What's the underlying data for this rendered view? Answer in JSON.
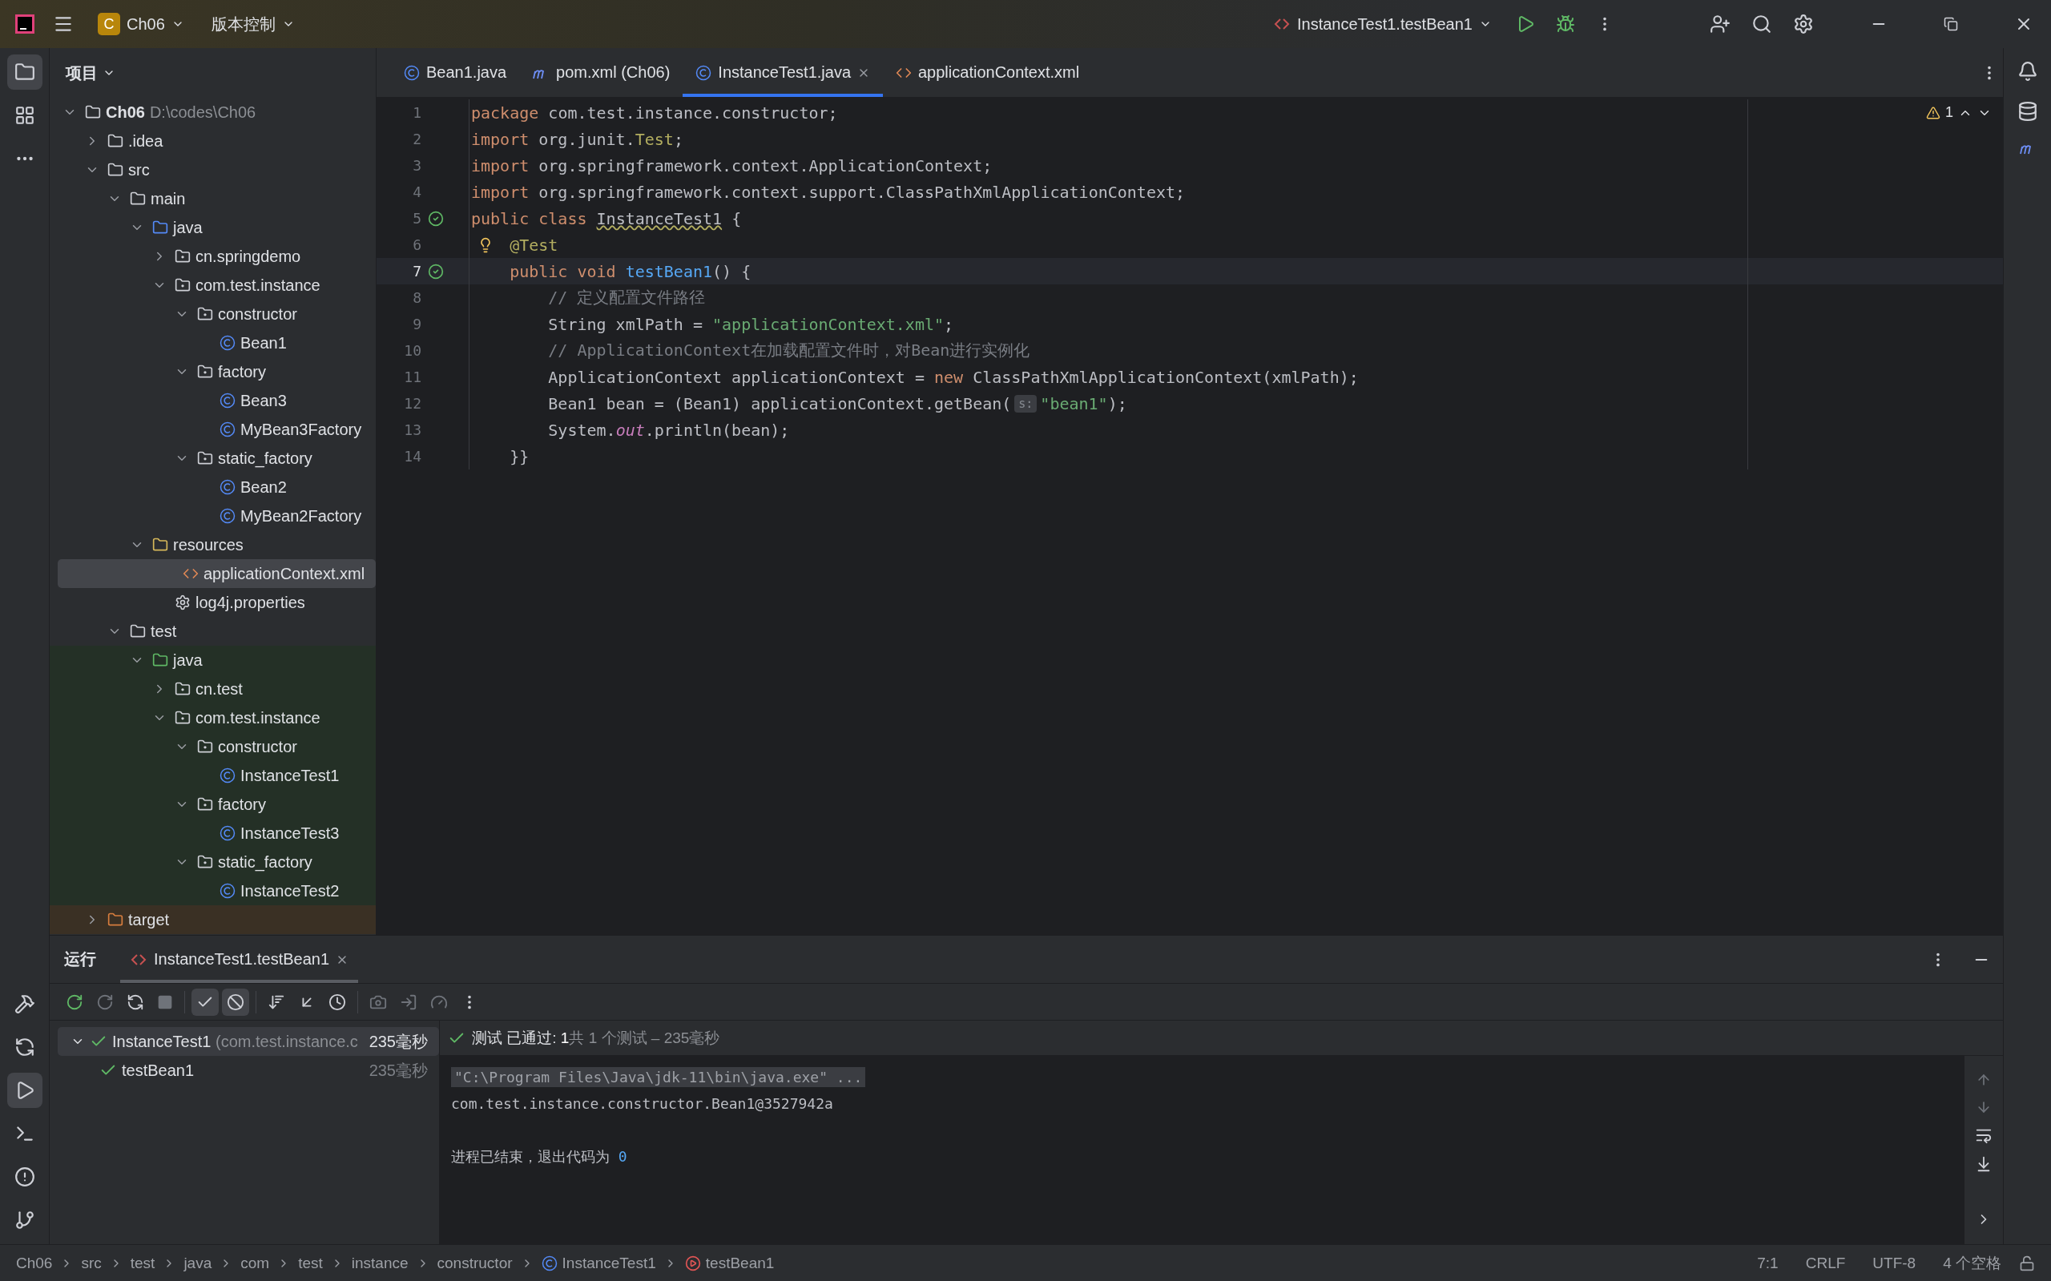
{
  "title_bar": {
    "project_badge": "C",
    "project": "Ch06",
    "vcs": "版本控制",
    "run_config": "InstanceTest1.testBean1"
  },
  "tool_strip_top": [
    {
      "selected": true
    },
    {
      "selected": false
    },
    {
      "selected": false
    }
  ],
  "tool_strip_bottom": [
    {
      "selected": false
    },
    {
      "selected": false
    },
    {
      "selected": true
    },
    {
      "selected": false
    },
    {
      "selected": false
    },
    {
      "selected": false
    }
  ],
  "project_panel": {
    "title": "项目",
    "tree": [
      {
        "name": "Ch06",
        "path": "D:\\codes\\Ch06",
        "kind": "project",
        "expanded": true,
        "selected": false,
        "children": [
          {
            "name": ".idea",
            "kind": "folder",
            "expanded": false,
            "selected": false
          },
          {
            "name": "src",
            "kind": "folder",
            "expanded": true,
            "selected": false,
            "children": [
              {
                "name": "main",
                "kind": "folder",
                "expanded": true,
                "selected": false,
                "children": [
                  {
                    "name": "java",
                    "kind": "source-folder",
                    "expanded": true,
                    "selected": false,
                    "children": [
                      {
                        "name": "cn.springdemo",
                        "kind": "package",
                        "expanded": false,
                        "selected": false
                      },
                      {
                        "name": "com.test.instance",
                        "kind": "package",
                        "expanded": true,
                        "selected": false,
                        "children": [
                          {
                            "name": "constructor",
                            "kind": "package",
                            "expanded": true,
                            "selected": false,
                            "children": [
                              {
                                "name": "Bean1",
                                "kind": "class",
                                "selected": false
                              }
                            ]
                          },
                          {
                            "name": "factory",
                            "kind": "package",
                            "expanded": true,
                            "selected": false,
                            "children": [
                              {
                                "name": "Bean3",
                                "kind": "class",
                                "selected": false
                              },
                              {
                                "name": "MyBean3Factory",
                                "kind": "class",
                                "selected": false
                              }
                            ]
                          },
                          {
                            "name": "static_factory",
                            "kind": "package",
                            "expanded": true,
                            "selected": false,
                            "children": [
                              {
                                "name": "Bean2",
                                "kind": "class",
                                "selected": false
                              },
                              {
                                "name": "MyBean2Factory",
                                "kind": "class",
                                "selected": false
                              }
                            ]
                          }
                        ]
                      }
                    ]
                  },
                  {
                    "name": "resources",
                    "kind": "resource-folder",
                    "expanded": true,
                    "selected": false,
                    "children": [
                      {
                        "name": "applicationContext.xml",
                        "kind": "xml",
                        "selected": true
                      },
                      {
                        "name": "log4j.properties",
                        "kind": "properties",
                        "selected": false
                      }
                    ]
                  }
                ]
              },
              {
                "name": "test",
                "kind": "folder",
                "expanded": true,
                "selected": false,
                "children": [
                  {
                    "name": "java",
                    "kind": "test-source-folder",
                    "expanded": true,
                    "selected": false,
                    "children": [
                      {
                        "name": "cn.test",
                        "kind": "package",
                        "expanded": false,
                        "selected": false
                      },
                      {
                        "name": "com.test.instance",
                        "kind": "package",
                        "expanded": true,
                        "selected": false,
                        "children": [
                          {
                            "name": "constructor",
                            "kind": "package",
                            "expanded": true,
                            "selected": false,
                            "children": [
                              {
                                "name": "InstanceTest1",
                                "kind": "class",
                                "selected": false
                              }
                            ]
                          },
                          {
                            "name": "factory",
                            "kind": "package",
                            "expanded": true,
                            "selected": false,
                            "children": [
                              {
                                "name": "InstanceTest3",
                                "kind": "class",
                                "selected": false
                              }
                            ]
                          },
                          {
                            "name": "static_factory",
                            "kind": "package",
                            "expanded": true,
                            "selected": false,
                            "children": [
                              {
                                "name": "InstanceTest2",
                                "kind": "class",
                                "selected": false
                              }
                            ]
                          }
                        ]
                      }
                    ]
                  }
                ]
              }
            ]
          },
          {
            "name": "target",
            "kind": "excluded-folder",
            "expanded": false,
            "selected": false
          }
        ]
      }
    ]
  },
  "editor_tabs": [
    {
      "label": "Bean1.java",
      "kind": "class",
      "selected": false
    },
    {
      "label": "pom.xml (Ch06)",
      "kind": "maven",
      "selected": false
    },
    {
      "label": "InstanceTest1.java",
      "kind": "class",
      "selected": true
    },
    {
      "label": "applicationContext.xml",
      "kind": "xml",
      "selected": false
    }
  ],
  "editor": {
    "warnings": "1",
    "lines": [
      {
        "number": "1",
        "tokens": [
          {
            "kind": "keyword",
            "text": "package"
          },
          {
            "kind": "plain",
            "text": " com.test.instance.constructor;"
          }
        ]
      },
      {
        "number": "2",
        "tokens": [
          {
            "kind": "keyword",
            "text": "import"
          },
          {
            "kind": "plain",
            "text": " org.junit."
          },
          {
            "kind": "annotation",
            "text": "Test"
          },
          {
            "kind": "plain",
            "text": ";"
          }
        ]
      },
      {
        "number": "3",
        "tokens": [
          {
            "kind": "keyword",
            "text": "import"
          },
          {
            "kind": "plain",
            "text": " org.springframework.context.ApplicationContext;"
          }
        ]
      },
      {
        "number": "4",
        "tokens": [
          {
            "kind": "keyword",
            "text": "import"
          },
          {
            "kind": "plain",
            "text": " org.springframework.context.support.ClassPathXmlApplicationContext;"
          }
        ]
      },
      {
        "number": "5",
        "run_marker": true,
        "tokens": [
          {
            "kind": "keyword",
            "text": "public class "
          },
          {
            "kind": "warning",
            "text": "InstanceTest1"
          },
          {
            "kind": "plain",
            "text": " {"
          }
        ]
      },
      {
        "number": "6",
        "bulb": true,
        "tokens": [
          {
            "kind": "annotation",
            "text": "    @Test"
          }
        ]
      },
      {
        "number": "7",
        "run_marker": true,
        "current": true,
        "tokens": [
          {
            "kind": "keyword",
            "text": "    public void "
          },
          {
            "kind": "method",
            "text": "testBean1"
          },
          {
            "kind": "plain",
            "text": "() {"
          }
        ]
      },
      {
        "number": "8",
        "tokens": [
          {
            "kind": "comment",
            "text": "        // 定义配置文件路径"
          }
        ]
      },
      {
        "number": "9",
        "tokens": [
          {
            "kind": "plain",
            "text": "        String xmlPath = "
          },
          {
            "kind": "string",
            "text": "\"applicationContext.xml\""
          },
          {
            "kind": "plain",
            "text": ";"
          }
        ]
      },
      {
        "number": "10",
        "tokens": [
          {
            "kind": "comment",
            "text": "        // ApplicationContext在加载配置文件时，对Bean进行实例化"
          }
        ]
      },
      {
        "number": "11",
        "tokens": [
          {
            "kind": "plain",
            "text": "        ApplicationContext applicationContext = "
          },
          {
            "kind": "keyword",
            "text": "new"
          },
          {
            "kind": "plain",
            "text": " ClassPathXmlApplicationContext(xmlPath);"
          }
        ]
      },
      {
        "number": "12",
        "tokens": [
          {
            "kind": "plain",
            "text": "        Bean1 bean = (Bean1) applicationContext.getBean("
          },
          {
            "kind": "hint",
            "text": "s:"
          },
          {
            "kind": "string",
            "text": "\"bean1\""
          },
          {
            "kind": "plain",
            "text": ");"
          }
        ]
      },
      {
        "number": "13",
        "tokens": [
          {
            "kind": "plain",
            "text": "        System."
          },
          {
            "kind": "static",
            "text": "out"
          },
          {
            "kind": "plain",
            "text": ".println(bean);"
          }
        ]
      },
      {
        "number": "14",
        "tokens": [
          {
            "kind": "plain",
            "text": "    }}"
          }
        ]
      }
    ]
  },
  "run_panel": {
    "title": "运行",
    "tabs": [
      {
        "label": "InstanceTest1.testBean1",
        "selected": true
      }
    ],
    "toggles": [
      {
        "on": true
      },
      {
        "on": true
      }
    ],
    "tests": [
      {
        "name": "InstanceTest1",
        "detail": "(com.test.instance.c",
        "time": "235毫秒",
        "passed": true,
        "expanded": true,
        "selected": true,
        "children": [
          {
            "name": "testBean1",
            "time": "235毫秒",
            "passed": true,
            "selected": false
          }
        ]
      }
    ],
    "summary": {
      "status": "测试 已通过: ",
      "count": "1",
      "detail": "共 1 个测试 – 235毫秒"
    },
    "console": [
      {
        "kind": "command",
        "text": "\"C:\\Program Files\\Java\\jdk-11\\bin\\java.exe\" ..."
      },
      {
        "kind": "output",
        "text": "com.test.instance.constructor.Bean1@3527942a"
      },
      {
        "kind": "blank"
      },
      {
        "kind": "exit",
        "text": "进程已结束，退出代码为 ",
        "code": "0"
      }
    ]
  },
  "status_bar": {
    "breadcrumbs": [
      {
        "label": "Ch06",
        "kind": "project"
      },
      {
        "label": "src",
        "kind": "folder"
      },
      {
        "label": "test",
        "kind": "folder"
      },
      {
        "label": "java",
        "kind": "folder"
      },
      {
        "label": "com",
        "kind": "folder"
      },
      {
        "label": "test",
        "kind": "folder"
      },
      {
        "label": "instance",
        "kind": "folder"
      },
      {
        "label": "constructor",
        "kind": "folder"
      },
      {
        "label": "InstanceTest1",
        "kind": "class"
      },
      {
        "label": "testBean1",
        "kind": "method"
      }
    ],
    "items": [
      "7:1",
      "CRLF",
      "UTF-8",
      "4 个空格"
    ]
  }
}
